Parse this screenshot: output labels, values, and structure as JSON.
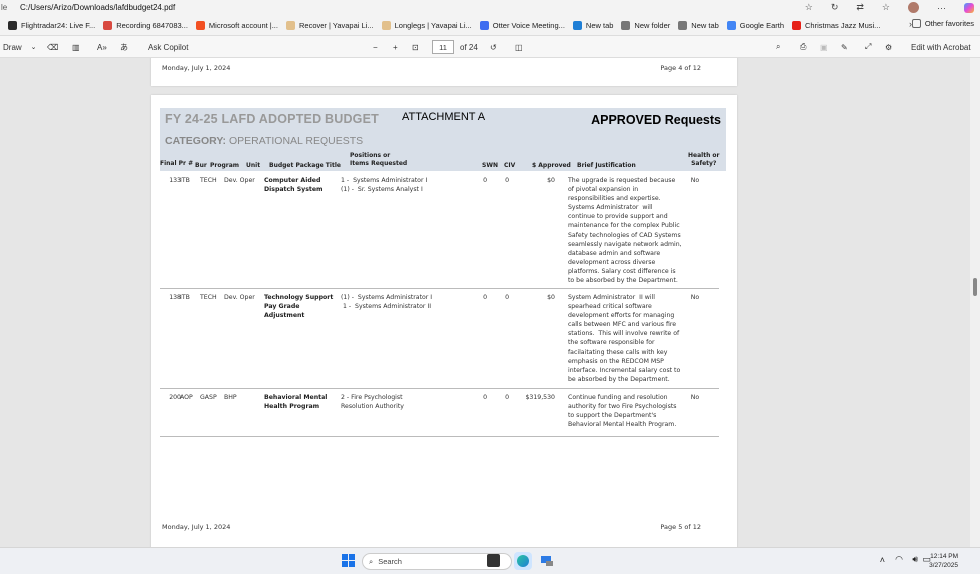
{
  "browser": {
    "address_prefix": "le",
    "url": "C:/Users/Arizo/Downloads/lafdbudget24.pdf",
    "more": "···"
  },
  "favorites": [
    {
      "label": "Flightradar24: Live F...",
      "color": "#2a2a2a"
    },
    {
      "label": "Recording 6847083...",
      "color": "#d8493f"
    },
    {
      "label": "Microsoft account |...",
      "color": "#f25022"
    },
    {
      "label": "Recover | Yavapai Li...",
      "color": "#e2c08c"
    },
    {
      "label": "Longlegs | Yavapai Li...",
      "color": "#e2c08c"
    },
    {
      "label": "Otter Voice Meeting...",
      "color": "#3d6cf0"
    },
    {
      "label": "New tab",
      "color": "#1f7fd6"
    },
    {
      "label": "New folder",
      "color": "#777777"
    },
    {
      "label": "New tab",
      "color": "#777777"
    },
    {
      "label": "Google Earth",
      "color": "#4285f4"
    },
    {
      "label": "Christmas Jazz Musi...",
      "color": "#e62117"
    }
  ],
  "favorites_other": "Other favorites",
  "pdf_toolbar": {
    "draw": "Draw",
    "ask_copilot": "Ask Copilot",
    "page_current": "11",
    "page_total": "of 24",
    "edit": "Edit with Acrobat"
  },
  "doc": {
    "top_footer_left": "Monday, July 1, 2024",
    "top_footer_right": "Page 4 of 12",
    "title": "FY 24-25 LAFD ADOPTED BUDGET",
    "attachment": "ATTACHMENT A",
    "approved": "APPROVED Requests",
    "category_label": "CATEGORY:",
    "category_value": "OPERATIONAL REQUESTS",
    "headers": {
      "final_pr": "Final Pr #",
      "bur": "Bur",
      "program": "Program",
      "unit": "Unit",
      "package": "Budget Package Title",
      "positions": "Positions or\nItems Requested",
      "swn": "SWN",
      "civ": "CIV",
      "approved": "$ Approved",
      "justification": "Brief Justification",
      "health": "Health or\nSafety?"
    },
    "rows": [
      {
        "final_pr": "133",
        "bur": "ITB",
        "program": "TECH",
        "unit": "Dev. Oper",
        "package": "Computer Aided\nDispatch System",
        "positions": "1 -  Systems Administrator I\n(1) -  Sr. Systems Analyst I",
        "swn": "0",
        "civ": "0",
        "approved": "$0",
        "justification": "The upgrade is requested because\nof pivotal expansion in\nresponsibilities and expertise.\nSystems Administrator  will\ncontinue to provide support and\nmaintenance for the complex Public\nSafety technologies of CAD Systems\nseamlessly navigate network admin,\ndatabase admin and software\ndevelopment across diverse\nplatforms. Salary cost difference is\nto be absorbed by the Department.",
        "health": "No"
      },
      {
        "final_pr": "138",
        "bur": "ITB",
        "program": "TECH",
        "unit": "Dev. Oper",
        "package": "Technology Support\nPay Grade\nAdjustment",
        "positions": "(1) -  Systems Administrator I\n 1 -  Systems Administrator II",
        "swn": "0",
        "civ": "0",
        "approved": "$0",
        "justification": "System Administrator  II will\nspearhead critical software\ndevelopment efforts for managing\ncalls between MFC and various fire\nstations.  This will involve rewrite of\nthe software responsible for\nfacilaitating these calls with key\nemphasis on the REDCOM MSP\ninterface. Incremental salary cost to\nbe absorbed by the Department.",
        "health": "No"
      },
      {
        "final_pr": "200",
        "bur": "AOP",
        "program": "GASP",
        "unit": "BHP",
        "package": "Behavioral Mental\nHealth Program",
        "positions": "2 - Fire Psychologist\nResolution Authority",
        "swn": "0",
        "civ": "0",
        "approved": "$319,530",
        "justification": "Continue funding and resolution\nauthority for two Fire Psychologists\nto support the Department's\nBehavioral Mental Health Program.",
        "health": "No"
      }
    ],
    "footer_left": "Monday, July 1, 2024",
    "footer_right": "Page 5 of 12"
  },
  "taskbar": {
    "search_placeholder": "Search",
    "time": "12:14 PM",
    "date": "3/27/2025"
  }
}
